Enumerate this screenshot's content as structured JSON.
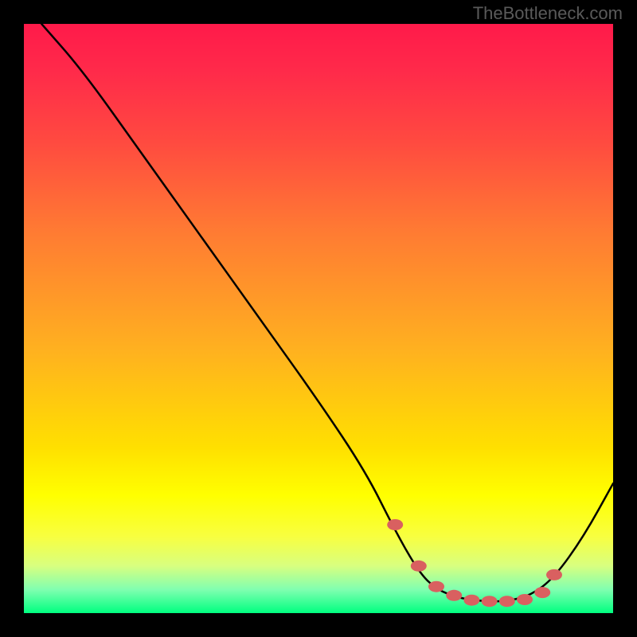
{
  "watermark": "TheBottleneck.com",
  "chart_data": {
    "type": "line",
    "title": "",
    "xlabel": "",
    "ylabel": "",
    "xlim": [
      0,
      100
    ],
    "ylim": [
      0,
      100
    ],
    "series": [
      {
        "name": "curve",
        "x": [
          3,
          10,
          20,
          30,
          40,
          50,
          58,
          63,
          67,
          70,
          74,
          78,
          82,
          86,
          90,
          95,
          100
        ],
        "y": [
          100,
          92,
          78,
          64,
          50,
          36,
          24,
          14,
          7,
          4,
          2.5,
          2,
          2,
          3,
          6,
          13,
          22
        ]
      }
    ],
    "markers": {
      "name": "dots",
      "color": "#d96060",
      "x": [
        63,
        67,
        70,
        73,
        76,
        79,
        82,
        85,
        88,
        90
      ],
      "y": [
        15,
        8,
        4.5,
        3,
        2.2,
        2,
        2,
        2.3,
        3.5,
        6.5
      ]
    },
    "gradient_stops": [
      {
        "pos": 0,
        "color": "#ff1a4a"
      },
      {
        "pos": 20,
        "color": "#ff4a40"
      },
      {
        "pos": 55,
        "color": "#ffb020"
      },
      {
        "pos": 80,
        "color": "#ffff00"
      },
      {
        "pos": 100,
        "color": "#00ff80"
      }
    ]
  }
}
